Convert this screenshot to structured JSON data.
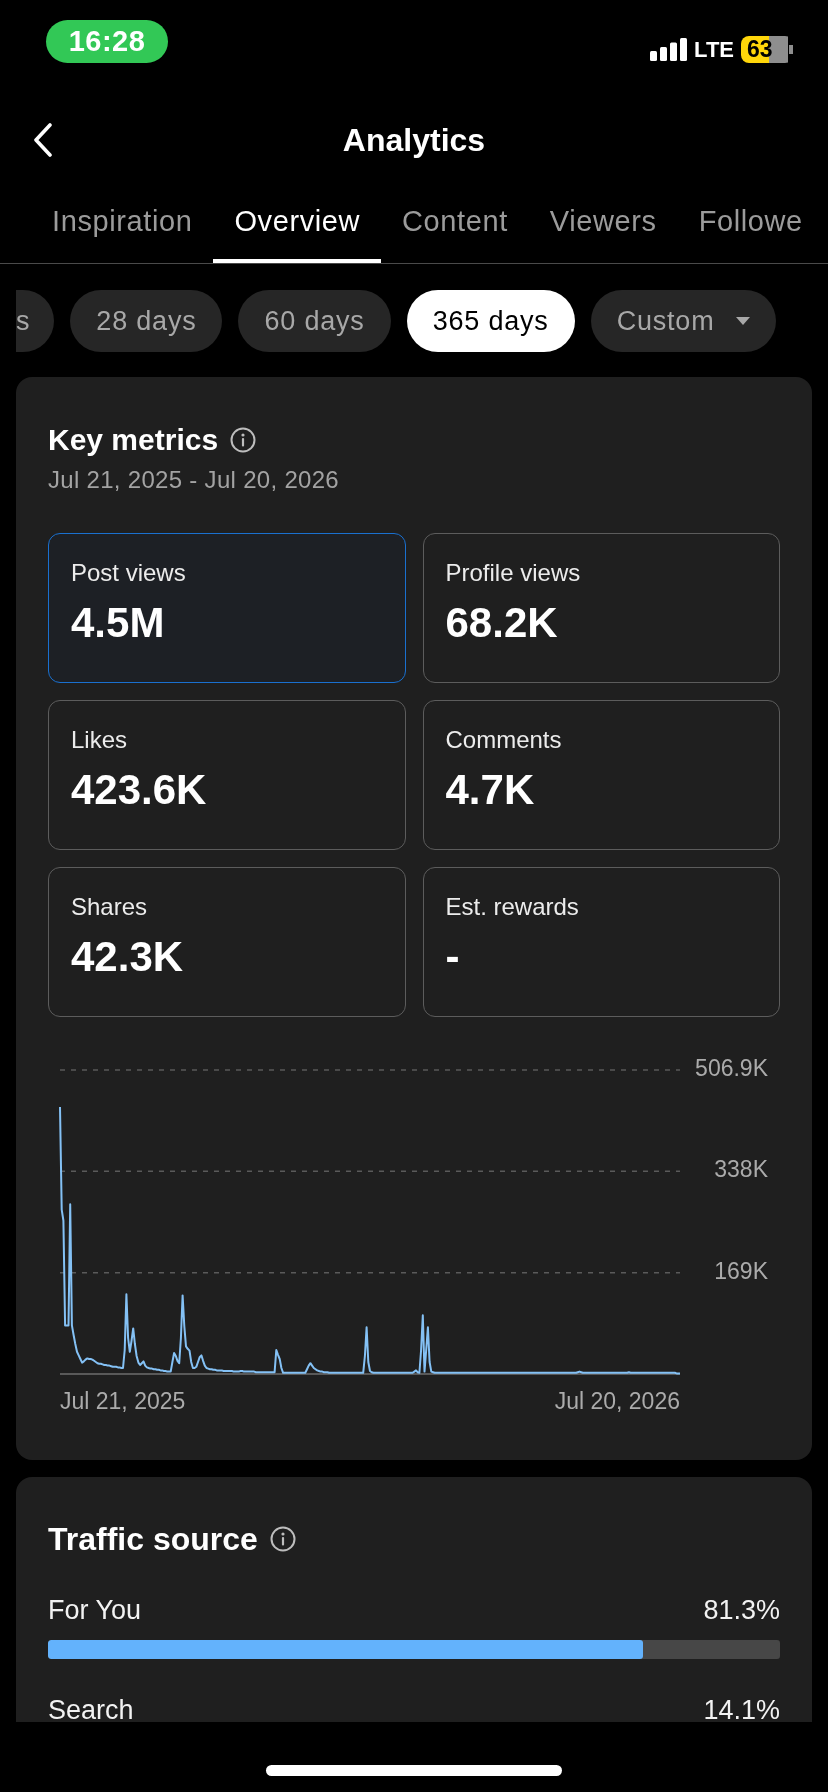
{
  "status_bar": {
    "time": "16:28",
    "network": "LTE",
    "battery": "63"
  },
  "header": {
    "title": "Analytics"
  },
  "tabs": [
    {
      "label": "Inspiration",
      "selected": false
    },
    {
      "label": "Overview",
      "selected": true
    },
    {
      "label": "Content",
      "selected": false
    },
    {
      "label": "Viewers",
      "selected": false
    },
    {
      "label": "Followe",
      "selected": false
    }
  ],
  "date_ranges": [
    {
      "label": "s",
      "selected": false,
      "kind": "chip"
    },
    {
      "label": "28 days",
      "selected": false,
      "kind": "chip"
    },
    {
      "label": "60 days",
      "selected": false,
      "kind": "chip"
    },
    {
      "label": "365 days",
      "selected": true,
      "kind": "chip"
    },
    {
      "label": "Custom",
      "selected": false,
      "kind": "dropdown"
    }
  ],
  "key_metrics": {
    "title": "Key metrics",
    "date_range": "Jul 21, 2025 - Jul 20, 2026",
    "metrics": [
      {
        "label": "Post views",
        "value": "4.5M",
        "selected": true
      },
      {
        "label": "Profile views",
        "value": "68.2K",
        "selected": false
      },
      {
        "label": "Likes",
        "value": "423.6K",
        "selected": false
      },
      {
        "label": "Comments",
        "value": "4.7K",
        "selected": false
      },
      {
        "label": "Shares",
        "value": "42.3K",
        "selected": false
      },
      {
        "label": "Est. rewards",
        "value": "-",
        "selected": false
      }
    ],
    "chart_axis_dates": [
      "Jul 21, 2025",
      "Jul 20, 2026"
    ],
    "chart_data": {
      "type": "line",
      "categories": [
        null,
        null,
        null,
        null,
        null,
        null,
        null,
        null,
        null,
        null,
        null,
        null,
        null,
        null,
        null,
        null,
        null,
        null,
        null,
        null,
        null,
        null,
        null,
        null,
        null,
        null,
        null,
        null,
        null,
        null,
        null,
        null,
        null,
        null,
        null,
        null,
        null,
        null,
        null,
        null,
        null,
        null,
        null,
        null,
        null,
        null,
        null,
        null,
        null,
        null,
        null,
        null,
        null,
        null,
        null,
        null,
        null,
        null,
        null,
        null,
        null,
        null,
        null,
        null,
        null,
        null,
        null,
        null,
        null,
        null,
        null,
        null,
        null,
        null,
        null,
        null,
        null,
        null,
        null,
        null,
        null,
        null,
        null,
        null,
        null,
        null,
        null,
        null,
        null,
        null,
        null,
        null,
        null,
        null,
        null,
        null,
        null,
        null,
        null,
        null,
        null,
        null,
        null,
        null,
        null,
        null,
        null,
        null,
        null,
        null,
        null,
        null,
        null,
        null,
        null,
        null,
        null,
        null,
        null,
        null,
        null,
        null,
        null,
        null,
        null,
        null,
        null,
        null,
        null,
        null,
        null,
        null,
        null,
        null,
        null,
        null,
        null,
        null,
        null,
        null,
        null,
        null,
        null,
        null,
        null,
        null,
        null,
        null,
        null,
        null,
        null,
        null,
        null,
        null,
        null,
        null,
        null,
        null,
        null,
        null,
        null,
        null,
        null,
        null,
        null,
        null,
        null,
        null,
        null,
        null,
        null,
        null,
        null,
        null,
        null,
        null,
        null,
        null,
        null,
        null,
        null,
        null,
        null,
        null,
        null,
        null,
        null,
        null,
        null,
        null,
        null,
        null,
        null,
        null,
        null,
        null,
        null,
        null,
        null,
        null,
        null,
        null,
        null,
        null,
        null,
        null,
        null,
        null,
        null,
        null,
        null,
        null,
        null,
        null,
        null,
        null,
        null,
        null,
        null,
        null,
        null,
        null,
        null,
        null,
        null,
        null,
        null,
        null,
        null,
        null,
        null,
        null,
        null,
        null,
        null,
        null,
        null,
        null,
        null,
        null,
        null,
        null,
        null,
        null,
        null,
        null,
        null,
        null,
        null,
        null,
        null,
        null,
        null,
        null,
        null,
        null,
        null,
        null,
        null,
        null,
        null,
        null,
        null,
        null,
        null,
        null,
        null,
        null,
        null,
        null,
        null,
        null,
        null,
        null,
        null,
        null,
        null,
        null,
        null,
        null,
        null,
        null,
        null,
        null,
        null,
        null,
        null,
        null,
        null,
        null,
        null,
        null,
        null,
        null,
        null,
        null,
        null,
        null,
        null,
        null,
        null,
        null,
        null,
        null,
        null,
        null,
        null,
        null,
        null,
        null,
        null,
        null,
        null,
        null,
        null,
        null,
        null,
        null,
        null,
        null,
        null,
        null,
        null,
        null,
        null,
        null,
        null,
        null,
        null,
        null,
        null,
        null,
        null,
        null,
        null,
        null,
        null,
        null,
        null,
        null,
        null,
        null,
        null,
        null,
        null,
        null,
        null,
        null,
        null,
        null,
        null,
        null,
        null,
        null,
        null,
        null,
        null,
        null,
        null,
        null,
        null,
        null,
        null,
        null,
        null
      ],
      "series": [
        {
          "color": "#84c1f5",
          "values": [
            445,
            274,
            256,
            81,
            81,
            81,
            283,
            81,
            65,
            50,
            37,
            31,
            25,
            19,
            21,
            24,
            26,
            25,
            25,
            24,
            22,
            20,
            18,
            17,
            17,
            16,
            15,
            15,
            14,
            14,
            13,
            12,
            12,
            12,
            11,
            11,
            10,
            10,
            40,
            133,
            60,
            37,
            55,
            76,
            50,
            30,
            19,
            15,
            18,
            21,
            14,
            11,
            10,
            9,
            9,
            8,
            8,
            7,
            7,
            6,
            6,
            5,
            5,
            4,
            4,
            4,
            20,
            35,
            30,
            22,
            18,
            60,
            131,
            80,
            46,
            42,
            39,
            20,
            10,
            10,
            12,
            20,
            28,
            31,
            22,
            14,
            10,
            9,
            8,
            8,
            7,
            7,
            6,
            6,
            6,
            6,
            5,
            5,
            5,
            5,
            5,
            5,
            4,
            4,
            4,
            4,
            5,
            5,
            4,
            4,
            4,
            4,
            4,
            4,
            4,
            3,
            3,
            3,
            3,
            3,
            3,
            3,
            3,
            3,
            3,
            3,
            3,
            40,
            32,
            25,
            10,
            2,
            2,
            2,
            2,
            2,
            2,
            2,
            2,
            2,
            2,
            2,
            2,
            2,
            2,
            8,
            14,
            18,
            14,
            10,
            8,
            6,
            5,
            4,
            4,
            3,
            3,
            3,
            2,
            2,
            2,
            2,
            2,
            2,
            2,
            2,
            2,
            2,
            2,
            2,
            2,
            2,
            2,
            2,
            2,
            2,
            2,
            2,
            2,
            30,
            78,
            20,
            5,
            3,
            2,
            2,
            2,
            2,
            2,
            2,
            2,
            2,
            2,
            2,
            2,
            2,
            2,
            2,
            2,
            2,
            2,
            2,
            2,
            2,
            2,
            2,
            2,
            2,
            4,
            6,
            3,
            2,
            40,
            98,
            4,
            40,
            78,
            20,
            4,
            3,
            2,
            2,
            2,
            2,
            2,
            2,
            2,
            2,
            2,
            2,
            2,
            2,
            2,
            2,
            2,
            2,
            2,
            2,
            2,
            2,
            2,
            2,
            2,
            2,
            2,
            2,
            2,
            2,
            2,
            2,
            2,
            2,
            2,
            2,
            2,
            2,
            2,
            2,
            2,
            2,
            2,
            2,
            2,
            2,
            2,
            2,
            2,
            2,
            2,
            2,
            2,
            2,
            2,
            2,
            2,
            2,
            2,
            2,
            2,
            2,
            2,
            2,
            2,
            2,
            2,
            2,
            2,
            2,
            2,
            2,
            2,
            2,
            2,
            2,
            2,
            2,
            2,
            2,
            2,
            2,
            2,
            2,
            2,
            2,
            3,
            4,
            3,
            2,
            2,
            2,
            2,
            2,
            2,
            2,
            2,
            2,
            2,
            2,
            2,
            2,
            2,
            2,
            2,
            2,
            2,
            2,
            2,
            2,
            2,
            2,
            2,
            2,
            2,
            2,
            3,
            2,
            2,
            2,
            2,
            2,
            2,
            2,
            2,
            2,
            2,
            2,
            2,
            2,
            2,
            2,
            2,
            2,
            2,
            2,
            2,
            2,
            2,
            2,
            2,
            2,
            2,
            2,
            1,
            1,
            1
          ]
        }
      ],
      "ylim": [
        0,
        506.9
      ],
      "yticks": [
        {
          "value": 169,
          "label": "169K"
        },
        {
          "value": 338,
          "label": "338K"
        },
        {
          "value": 506.9,
          "label": "506.9K"
        }
      ]
    }
  },
  "traffic_source": {
    "title": "Traffic source",
    "sources": [
      {
        "name": "For You",
        "share": "81.3%",
        "level": 0.813
      },
      {
        "name": "Search",
        "share": "14.1%"
      }
    ]
  }
}
